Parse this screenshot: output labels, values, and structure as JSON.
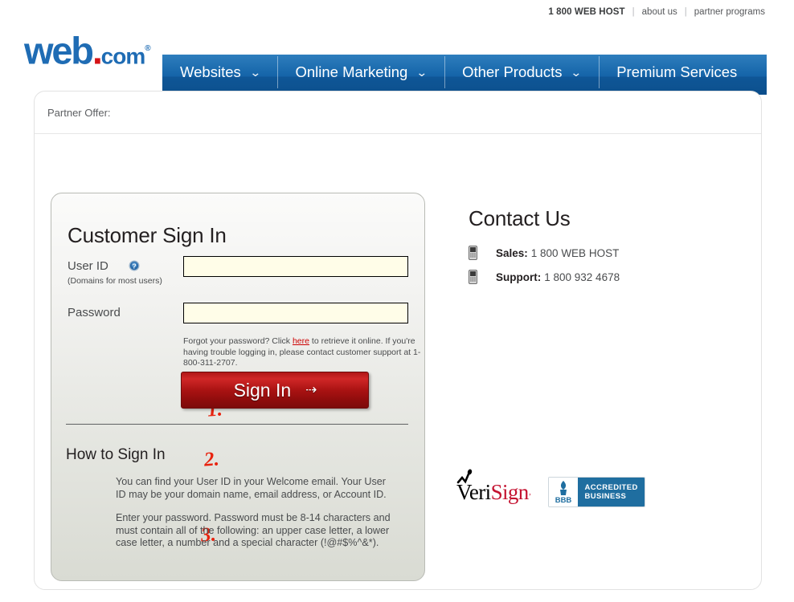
{
  "utility": {
    "phone": "1 800 WEB HOST",
    "separator": "|",
    "links": [
      {
        "label": "about us"
      },
      {
        "label": "partner programs"
      }
    ]
  },
  "brand": {
    "logo_web": "web",
    "logo_dot": ".",
    "logo_com": "com",
    "logo_reg": "®",
    "blue": "#1463a8",
    "red": "#d51317"
  },
  "nav": {
    "items": [
      {
        "label": "Websites",
        "caret": "⌄",
        "has_caret": true
      },
      {
        "label": "Online Marketing",
        "caret": "⌄",
        "has_caret": true
      },
      {
        "label": "Other Products",
        "caret": "⌄",
        "has_caret": true
      },
      {
        "label": "Premium Services",
        "caret": "",
        "has_caret": false
      }
    ]
  },
  "partner_offer": {
    "label": "Partner Offer:"
  },
  "signin": {
    "title": "Customer Sign In",
    "userid": {
      "label": "User ID",
      "sublabel": "(Domains for most users)",
      "value": "",
      "placeholder": "",
      "help_icon": "help-circle-icon"
    },
    "password": {
      "label": "Password",
      "value": "",
      "placeholder": ""
    },
    "forgot": {
      "line1_before": "Forgot your password? Click ",
      "link": "here",
      "line1_after": " to retrieve it online.",
      "line2": "If you're having trouble logging in, please contact customer support at 1-800-311-2707."
    },
    "button": {
      "label": "Sign In",
      "arrow": "⇢",
      "color": "#a81212"
    },
    "annotations": [
      {
        "text": "1."
      },
      {
        "text": "2."
      },
      {
        "text": "3."
      }
    ],
    "howto": {
      "title": "How to Sign In",
      "paragraph1": "You can find your User ID in your Welcome email. Your User ID may be your domain name, email address, or Account ID.",
      "paragraph2": "Enter your password. Password must be 8-14 characters and must contain all of the following: an upper case letter, a lower case letter, a number and a special character (!@#$%^&*)."
    }
  },
  "contact": {
    "title": "Contact Us",
    "rows": [
      {
        "icon": "mobile-phone-icon",
        "label": "Sales:",
        "value": "1 800 WEB HOST"
      },
      {
        "icon": "mobile-phone-icon",
        "label": "Support:",
        "value": "1 800 932 4678"
      }
    ]
  },
  "badges": {
    "verisign": {
      "part1": "Veri",
      "part2": "Sign",
      "tm": "’"
    },
    "bbb": {
      "mark": "BBB",
      "line1": "ACCREDITED",
      "line2": "BUSINESS"
    }
  }
}
